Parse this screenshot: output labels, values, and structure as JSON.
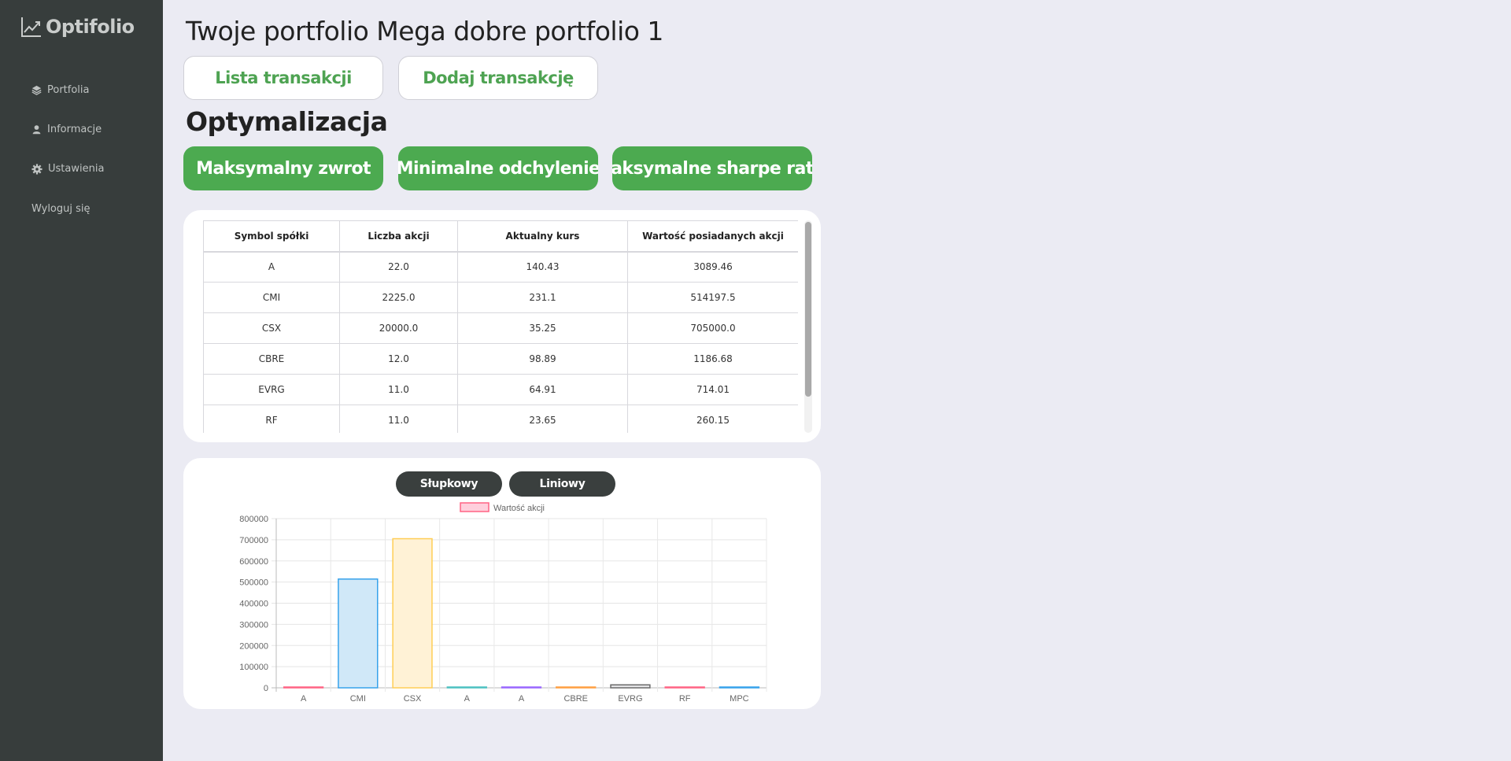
{
  "brand": {
    "name": "Optifolio"
  },
  "sidebar": {
    "items": [
      {
        "label": "Portfolia",
        "icon": "layers-icon"
      },
      {
        "label": "Informacje",
        "icon": "user-icon"
      },
      {
        "label": "Ustawienia",
        "icon": "gear-icon"
      },
      {
        "label": "Wyloguj się",
        "icon": ""
      }
    ]
  },
  "header": {
    "title": "Twoje portfolio Mega dobre portfolio 1",
    "list_button": "Lista transakcji",
    "add_button": "Dodaj transakcję"
  },
  "optimization": {
    "title": "Optymalizacja",
    "buttons": [
      "Maksymalny zwrot",
      "Minimalne odchylenie",
      "Maksymalne sharpe ratio"
    ]
  },
  "holdings_table": {
    "columns": [
      "Symbol spółki",
      "Liczba akcji",
      "Aktualny kurs",
      "Wartość posiadanych akcji"
    ],
    "rows": [
      [
        "A",
        "22.0",
        "140.43",
        "3089.46"
      ],
      [
        "CMI",
        "2225.0",
        "231.1",
        "514197.5"
      ],
      [
        "CSX",
        "20000.0",
        "35.25",
        "705000.0"
      ],
      [
        "CBRE",
        "12.0",
        "98.89",
        "1186.68"
      ],
      [
        "EVRG",
        "11.0",
        "64.91",
        "714.01"
      ],
      [
        "RF",
        "11.0",
        "23.65",
        "260.15"
      ]
    ]
  },
  "chart_controls": {
    "bar_label": "Słupkowy",
    "line_label": "Liniowy"
  },
  "chart_data": {
    "type": "bar",
    "categories": [
      "A",
      "CMI",
      "CSX",
      "A",
      "A",
      "CBRE",
      "EVRG",
      "RF",
      "MPC"
    ],
    "series": [
      {
        "name": "Wartość akcji",
        "values": [
          3089.46,
          514197.5,
          705000.0,
          1500,
          800,
          1186.68,
          14000,
          260.15,
          300
        ]
      }
    ],
    "ylim": [
      0,
      800000
    ],
    "yticks": [
      0,
      100000,
      200000,
      300000,
      400000,
      500000,
      600000,
      700000,
      800000
    ],
    "grid": true,
    "legend": "top-center",
    "colors": {
      "fill": [
        "#ffcfdc",
        "#d0e8f8",
        "#fff2d6",
        "#d2f2f0",
        "#e6ddff",
        "#ffe4cc",
        "#e4e4e6",
        "#ffcfdc",
        "#d0e8f8"
      ],
      "stroke": [
        "#ff6384",
        "#36a2eb",
        "#ffce56",
        "#4bc0c0",
        "#9966ff",
        "#ff9f40",
        "#6b6b6b",
        "#ff6384",
        "#36a2eb"
      ]
    }
  }
}
